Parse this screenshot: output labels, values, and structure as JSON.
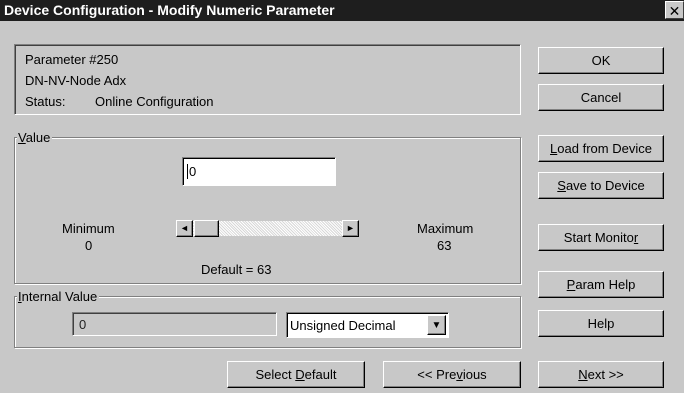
{
  "window": {
    "title": "Device Configuration - Modify Numeric Parameter",
    "close_glyph": "✕"
  },
  "info": {
    "parameter": "Parameter #250",
    "name": "DN-NV-Node Adx",
    "status_label": "Status:",
    "status_value": "Online Configuration"
  },
  "value_group": {
    "legend_u": "V",
    "legend_rest": "alue",
    "input_value": "0",
    "min_label": "Minimum",
    "min_value": "0",
    "max_label": "Maximum",
    "max_value": "63",
    "slider_fraction": 0.0,
    "default_text": "Default = 63",
    "left_arrow": "◄",
    "right_arrow": "►"
  },
  "internal_group": {
    "legend_u": "I",
    "legend_rest": "nternal Value",
    "value": "0",
    "format_selected": "Unsigned Decimal",
    "dropdown_arrow": "▼"
  },
  "buttons": {
    "ok": "OK",
    "cancel": "Cancel",
    "load_u": "L",
    "load_rest": "oad from Device",
    "save_u": "S",
    "save_rest": "ave to Device",
    "monitor_pre": "Start Monito",
    "monitor_u": "r",
    "param_u": "P",
    "param_rest": "aram Help",
    "help": "Help",
    "select_pre": "Select ",
    "select_u": "D",
    "select_rest": "efault",
    "prev_pre": "<< Pre",
    "prev_u": "v",
    "prev_rest": "ious",
    "next_u": "N",
    "next_rest": "ext >>"
  }
}
